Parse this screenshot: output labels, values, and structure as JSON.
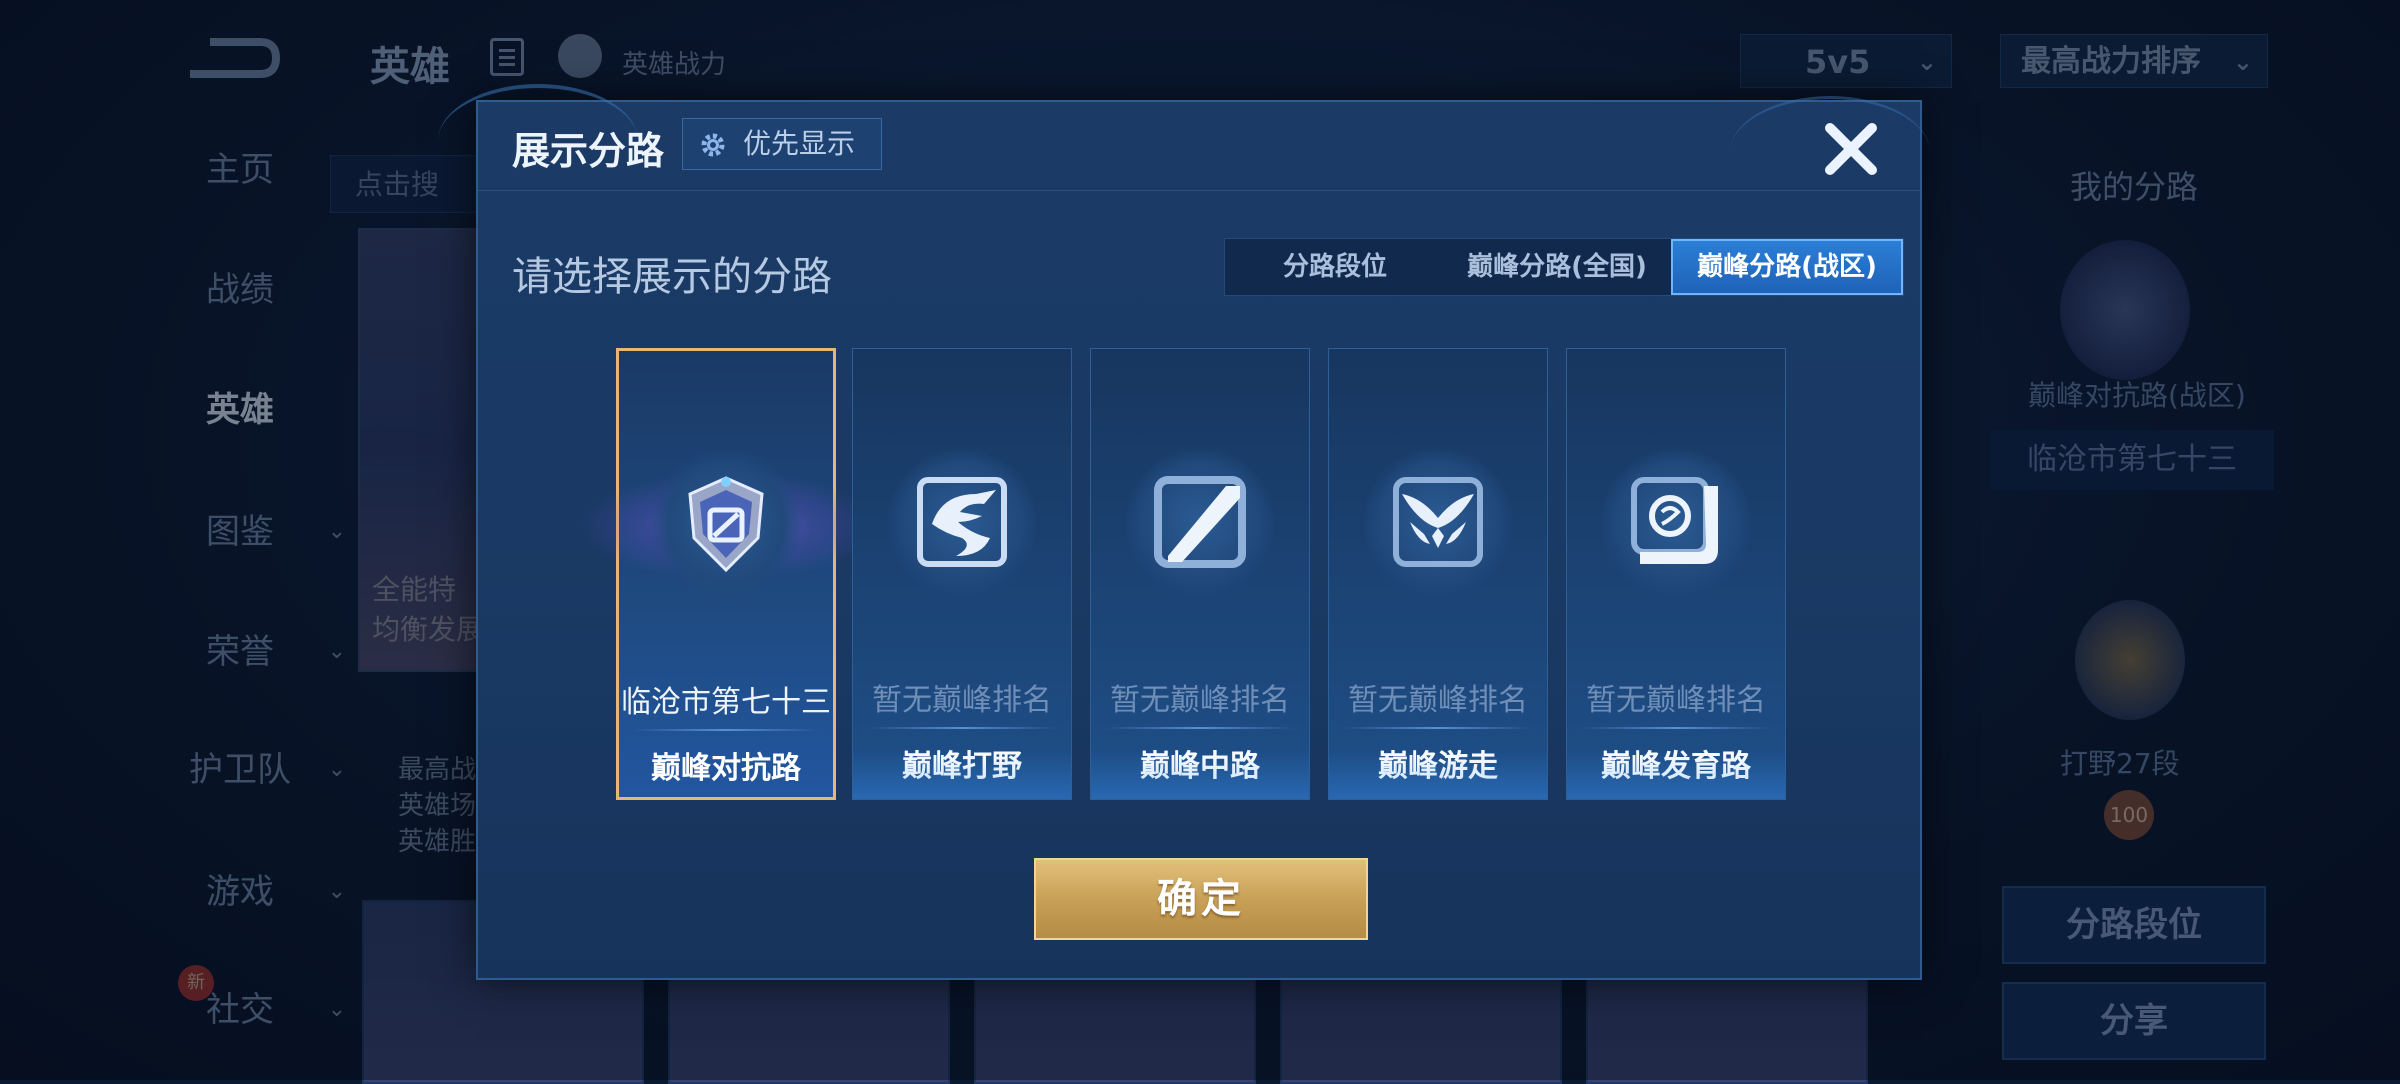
{
  "background": {
    "page_title": "英雄",
    "power_label": "英雄战力",
    "mode_select": "5v5",
    "sort_select": "最高战力排序",
    "search_stub": "点击搜",
    "sidebar": [
      {
        "label": "主页",
        "chevron": false
      },
      {
        "label": "战绩",
        "chevron": false
      },
      {
        "label": "英雄",
        "chevron": false,
        "active": true
      },
      {
        "label": "图鉴",
        "chevron": true
      },
      {
        "label": "荣誉",
        "chevron": true
      },
      {
        "label": "护卫队",
        "chevron": true
      },
      {
        "label": "游戏",
        "chevron": true
      },
      {
        "label": "社交",
        "chevron": true
      }
    ],
    "new_badge": "新",
    "hero_card_text": "全能特\n均衡发展",
    "hero_stats": [
      "最高战",
      "英雄场",
      "英雄胜"
    ],
    "right_panel": {
      "title": "我的分路",
      "rank_label": "巅峰对抗路(战区)",
      "city": "临沧市第七十三",
      "jungle_rank": "打野27段",
      "score": "100",
      "lane_rank_button": "分路段位",
      "share_button": "分享"
    }
  },
  "dialog": {
    "title": "展示分路",
    "priority_button": "优先显示",
    "prompt": "请选择展示的分路",
    "tabs": [
      {
        "label": "分路段位",
        "active": false
      },
      {
        "label": "巅峰分路(全国)",
        "active": false
      },
      {
        "label": "巅峰分路(战区)",
        "active": true
      }
    ],
    "cards": [
      {
        "rank": "临沧市第七十三",
        "name": "巅峰对抗路",
        "icon": "shield-emblem-icon",
        "selected": true
      },
      {
        "rank": "暂无巅峰排名",
        "name": "巅峰打野",
        "icon": "dragon-icon",
        "selected": false
      },
      {
        "rank": "暂无巅峰排名",
        "name": "巅峰中路",
        "icon": "slash-icon",
        "selected": false
      },
      {
        "rank": "暂无巅峰排名",
        "name": "巅峰游走",
        "icon": "wings-icon",
        "selected": false
      },
      {
        "rank": "暂无巅峰排名",
        "name": "巅峰发育路",
        "icon": "corner-target-icon",
        "selected": false
      }
    ],
    "confirm_button": "确定"
  },
  "colors": {
    "accent_tab": "#2c7ed6",
    "selected_border": "#e7b676",
    "confirm_gold": "#c9a057"
  }
}
